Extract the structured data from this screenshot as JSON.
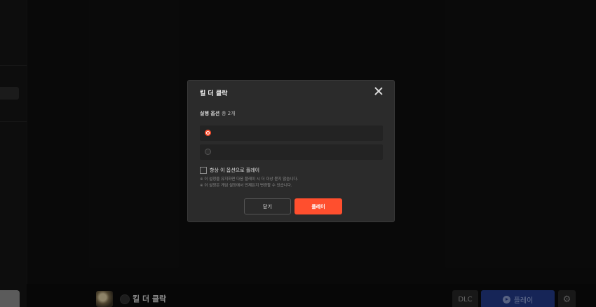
{
  "colors": {
    "accent": "#ff4f2e",
    "play_button": "#223a86",
    "modal_bg": "#2b2b2b"
  },
  "bottombar": {
    "game_title": "킬 더 클락",
    "dlc_label": "DLC",
    "play_label": "플레이",
    "play_icon": "play-circle-icon",
    "settings_icon": "gear-icon"
  },
  "modal": {
    "title": "킬 더 클락",
    "close_icon": "close-icon",
    "section_label": "실행 옵션",
    "section_count": "총 2개",
    "options": [
      {
        "label": "",
        "selected": true
      },
      {
        "label": "",
        "selected": false
      }
    ],
    "always_checkbox_label": "항상 이 옵션으로 플레이",
    "always_checked": false,
    "notes": [
      "※ 이 설정을 유지하면 다음 플레이 시 더 이상 묻지 않습니다.",
      "※ 이 설정은 게임 설정에서 언제든지 변경할 수 있습니다."
    ],
    "close_button": "닫기",
    "play_button": "플레이"
  }
}
